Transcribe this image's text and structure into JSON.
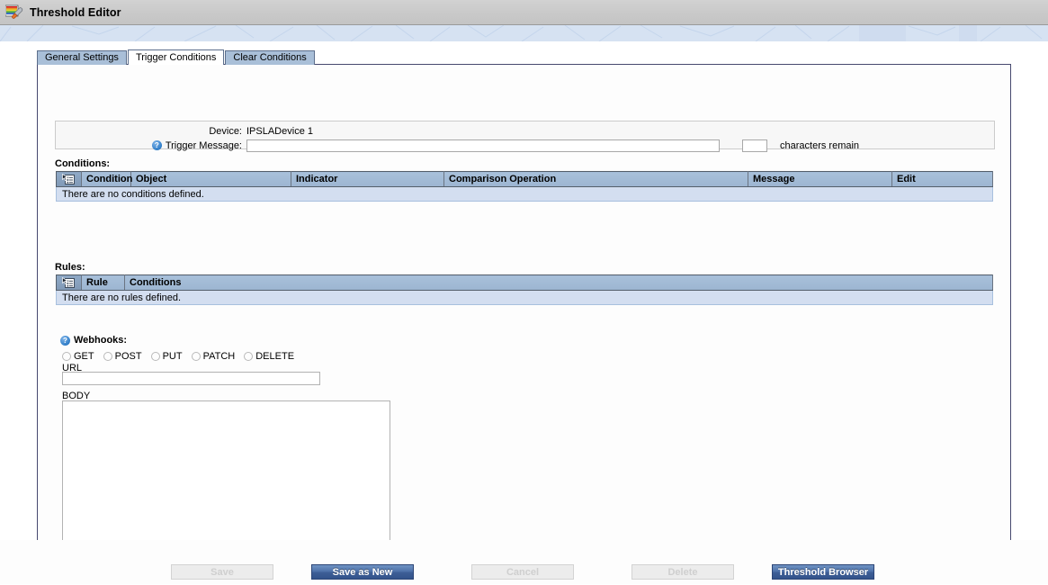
{
  "window": {
    "title": "Threshold Editor",
    "icon": "threshold-wrench-icon"
  },
  "tabs": [
    {
      "label": "General Settings",
      "active": false
    },
    {
      "label": "Trigger Conditions",
      "active": true
    },
    {
      "label": "Clear Conditions",
      "active": false
    }
  ],
  "device_box": {
    "device_label": "Device:",
    "device_value": "IPSLADevice 1",
    "trigger_label": "Trigger Message:",
    "trigger_help_icon": "help-icon",
    "trigger_value": "",
    "trigger_placeholder": "",
    "chars_remain_value": "",
    "chars_remain_label": "characters remain"
  },
  "conditions": {
    "section_label": "Conditions:",
    "select_icon": "select-all-rows-icon",
    "columns": [
      "Condition",
      "Object",
      "Indicator",
      "Comparison Operation",
      "Message",
      "Edit"
    ],
    "empty_message": "There are no conditions defined.",
    "rows": []
  },
  "rules": {
    "section_label": "Rules:",
    "select_icon": "select-all-rows-icon",
    "columns": [
      "Rule",
      "Conditions"
    ],
    "empty_message": "There are no rules defined.",
    "rows": []
  },
  "webhooks": {
    "help_icon": "help-icon",
    "title": "Webhooks:",
    "methods": [
      {
        "label": "GET",
        "selected": false
      },
      {
        "label": "POST",
        "selected": false
      },
      {
        "label": "PUT",
        "selected": false
      },
      {
        "label": "PATCH",
        "selected": false
      },
      {
        "label": "DELETE",
        "selected": false
      }
    ],
    "url_label": "URL",
    "url_value": "",
    "body_label": "BODY",
    "body_value": ""
  },
  "footer": {
    "buttons": [
      {
        "label": "Save",
        "state": "disabled"
      },
      {
        "label": "Save as New",
        "state": "primary"
      },
      {
        "label": "Cancel",
        "state": "disabled"
      },
      {
        "label": "Delete",
        "state": "disabled"
      },
      {
        "label": "Threshold Browser",
        "state": "primary"
      }
    ]
  },
  "colors": {
    "titlebar": "#c9c9c9",
    "deco_band": "#d6e2f2",
    "panel_border": "#46496e",
    "grid_header": "#9cb5d1",
    "grid_row": "#d3def0",
    "tab_inactive": "#a9bfd8",
    "primary_button": "#4d70a8",
    "help_blue": "#2f7dc8"
  }
}
